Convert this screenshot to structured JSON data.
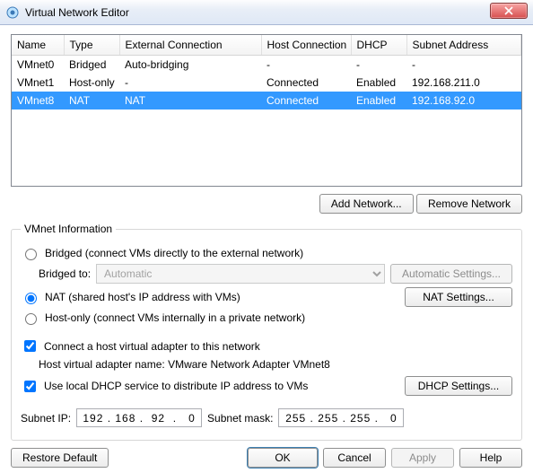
{
  "window": {
    "title": "Virtual Network Editor"
  },
  "table": {
    "headers": {
      "name": "Name",
      "type": "Type",
      "ext": "External Connection",
      "host": "Host Connection",
      "dhcp": "DHCP",
      "subnet": "Subnet Address"
    },
    "rows": [
      {
        "name": "VMnet0",
        "type": "Bridged",
        "ext": "Auto-bridging",
        "host": "-",
        "dhcp": "-",
        "subnet": "-"
      },
      {
        "name": "VMnet1",
        "type": "Host-only",
        "ext": "-",
        "host": "Connected",
        "dhcp": "Enabled",
        "subnet": "192.168.211.0"
      },
      {
        "name": "VMnet8",
        "type": "NAT",
        "ext": "NAT",
        "host": "Connected",
        "dhcp": "Enabled",
        "subnet": "192.168.92.0"
      }
    ],
    "selected_index": 2
  },
  "buttons": {
    "add_network": "Add Network...",
    "remove_network": "Remove Network",
    "automatic_settings": "Automatic Settings...",
    "nat_settings": "NAT Settings...",
    "dhcp_settings": "DHCP Settings...",
    "restore_default": "Restore Default",
    "ok": "OK",
    "cancel": "Cancel",
    "apply": "Apply",
    "help": "Help"
  },
  "info": {
    "legend": "VMnet Information",
    "bridged_label": "Bridged (connect VMs directly to the external network)",
    "bridged_to_label": "Bridged to:",
    "bridged_to_value": "Automatic",
    "nat_label": "NAT (shared host's IP address with VMs)",
    "hostonly_label": "Host-only (connect VMs internally in a private network)",
    "connect_host_adapter": "Connect a host virtual adapter to this network",
    "host_adapter_name_label": "Host virtual adapter name:",
    "host_adapter_name_value": "VMware Network Adapter VMnet8",
    "use_dhcp": "Use local DHCP service to distribute IP address to VMs",
    "subnet_ip_label": "Subnet IP:",
    "subnet_ip_value": "192 . 168 .  92  .   0",
    "subnet_mask_label": "Subnet mask:",
    "subnet_mask_value": "255 . 255 . 255 .   0"
  }
}
